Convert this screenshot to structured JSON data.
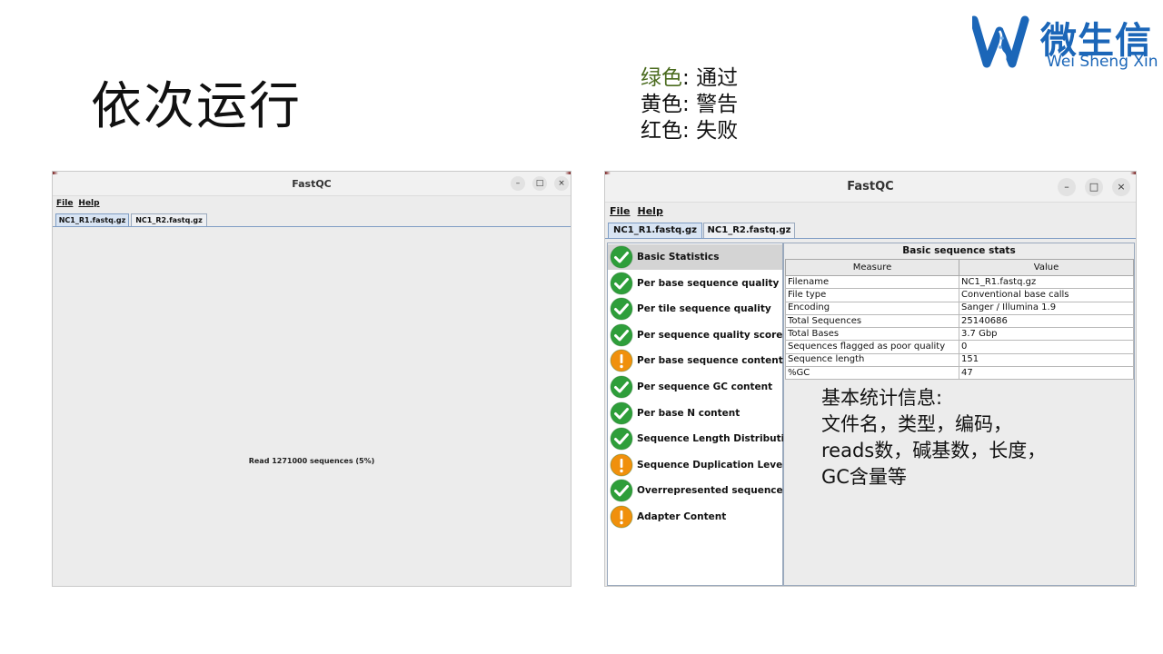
{
  "slide": {
    "title": "依次运行",
    "legend": [
      {
        "label": "绿色",
        "sep": ": ",
        "meaning": "通过",
        "color": "#4a6b1e"
      },
      {
        "label": "黄色",
        "sep": ": ",
        "meaning": "警告",
        "color": "#111111"
      },
      {
        "label": "红色",
        "sep": ": ",
        "meaning": "失败",
        "color": "#111111"
      }
    ],
    "logo": {
      "brand": "微生信",
      "sub": "Wei Sheng Xin",
      "color": "#1b66b8"
    }
  },
  "window1": {
    "title": "FastQC",
    "menu": [
      "File",
      "Help"
    ],
    "tabs": [
      "NC1_R1.fastq.gz",
      "NC1_R2.fastq.gz"
    ],
    "status": "Read 1271000 sequences (5%)",
    "buttons": {
      "minimize": "–",
      "maximize": "□",
      "close": "×"
    }
  },
  "window2": {
    "title": "FastQC",
    "menu": [
      "File",
      "Help"
    ],
    "tabs": [
      "NC1_R1.fastq.gz",
      "NC1_R2.fastq.gz"
    ],
    "buttons": {
      "minimize": "–",
      "maximize": "□",
      "close": "×"
    },
    "modules": [
      {
        "label": "Basic Statistics",
        "status": "pass"
      },
      {
        "label": "Per base sequence quality",
        "status": "pass"
      },
      {
        "label": "Per tile sequence quality",
        "status": "pass"
      },
      {
        "label": "Per sequence quality scores",
        "status": "pass"
      },
      {
        "label": "Per base sequence content",
        "status": "warn"
      },
      {
        "label": "Per sequence GC content",
        "status": "pass"
      },
      {
        "label": "Per base N content",
        "status": "pass"
      },
      {
        "label": "Sequence Length Distribution",
        "status": "pass"
      },
      {
        "label": "Sequence Duplication Levels",
        "status": "warn"
      },
      {
        "label": "Overrepresented sequences",
        "status": "pass"
      },
      {
        "label": "Adapter Content",
        "status": "warn"
      }
    ],
    "report": {
      "title": "Basic sequence stats",
      "headers": [
        "Measure",
        "Value"
      ],
      "rows": [
        [
          "Filename",
          "NC1_R1.fastq.gz"
        ],
        [
          "File type",
          "Conventional base calls"
        ],
        [
          "Encoding",
          "Sanger / Illumina 1.9"
        ],
        [
          "Total Sequences",
          "25140686"
        ],
        [
          "Total Bases",
          "3.7 Gbp"
        ],
        [
          "Sequences flagged as poor quality",
          "0"
        ],
        [
          "Sequence length",
          "151"
        ],
        [
          "%GC",
          "47"
        ]
      ]
    }
  },
  "annotation": [
    "基本统计信息:",
    "文件名，类型，编码，",
    "reads数，碱基数，长度，",
    "GC含量等"
  ],
  "colors": {
    "pass": "#2e9e3a",
    "warn": "#f0900c"
  }
}
